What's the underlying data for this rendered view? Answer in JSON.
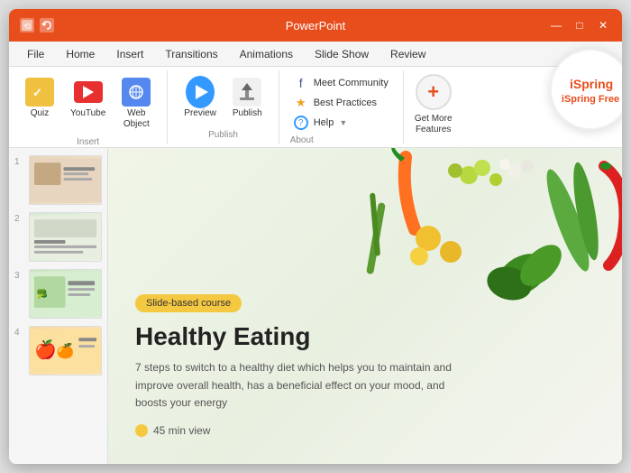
{
  "window": {
    "title": "PowerPoint",
    "controls": {
      "minimize": "—",
      "maximize": "□",
      "close": "✕"
    }
  },
  "menu": {
    "items": [
      "File",
      "Home",
      "Insert",
      "Transitions",
      "Animations",
      "Slide Show",
      "Review"
    ]
  },
  "ribbon": {
    "insert_group": {
      "label": "Insert",
      "quiz_label": "Quiz",
      "youtube_label": "YouTube",
      "web_label": "Web\nObject"
    },
    "publish_group": {
      "label": "Publish",
      "preview_label": "Preview",
      "publish_label": "Publish"
    },
    "about_group": {
      "label": "About",
      "community_label": "Meet Community",
      "practices_label": "Best Practices",
      "help_label": "Help"
    },
    "get_more_label": "Get More\nFeatures"
  },
  "ispring_badge": "iSpring Free",
  "slides": [
    {
      "number": "1"
    },
    {
      "number": "2"
    },
    {
      "number": "3"
    },
    {
      "number": "4"
    }
  ],
  "main_slide": {
    "badge": "Slide-based course",
    "title": "Healthy Eating",
    "description": "7 steps to switch to a healthy diet which helps you to maintain and improve overall health, has a beneficial effect on your mood, and boosts your energy",
    "duration": "45 min view"
  }
}
